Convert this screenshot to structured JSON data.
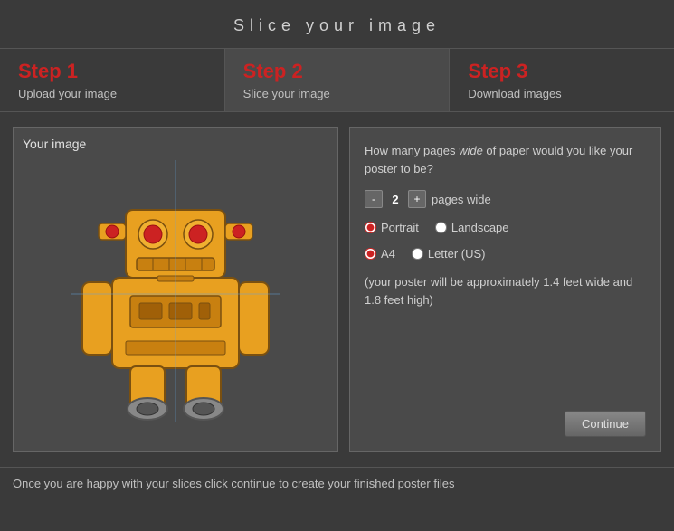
{
  "page": {
    "title": "Slice your image"
  },
  "steps": [
    {
      "id": "step1",
      "label": "Step 1",
      "desc": "Upload your image",
      "active": false
    },
    {
      "id": "step2",
      "label": "Step 2",
      "desc": "Slice your image",
      "active": true
    },
    {
      "id": "step3",
      "label": "Step 3",
      "desc": "Download images",
      "active": false
    }
  ],
  "image_panel": {
    "title": "Your image"
  },
  "controls": {
    "question": "How many pages wide of paper would you like your poster to be?",
    "question_wide_word": "wide",
    "pages_count": "2",
    "pages_suffix": "pages wide",
    "orientation_label_portrait": "Portrait",
    "orientation_label_landscape": "Landscape",
    "paper_label_a4": "A4",
    "paper_label_letter": "Letter (US)",
    "poster_info": "(your poster will be approximately 1.4 feet wide and 1.8 feet high)",
    "continue_label": "Continue"
  },
  "footer": {
    "text": "Once you are happy with your slices click continue to create your finished poster files"
  }
}
